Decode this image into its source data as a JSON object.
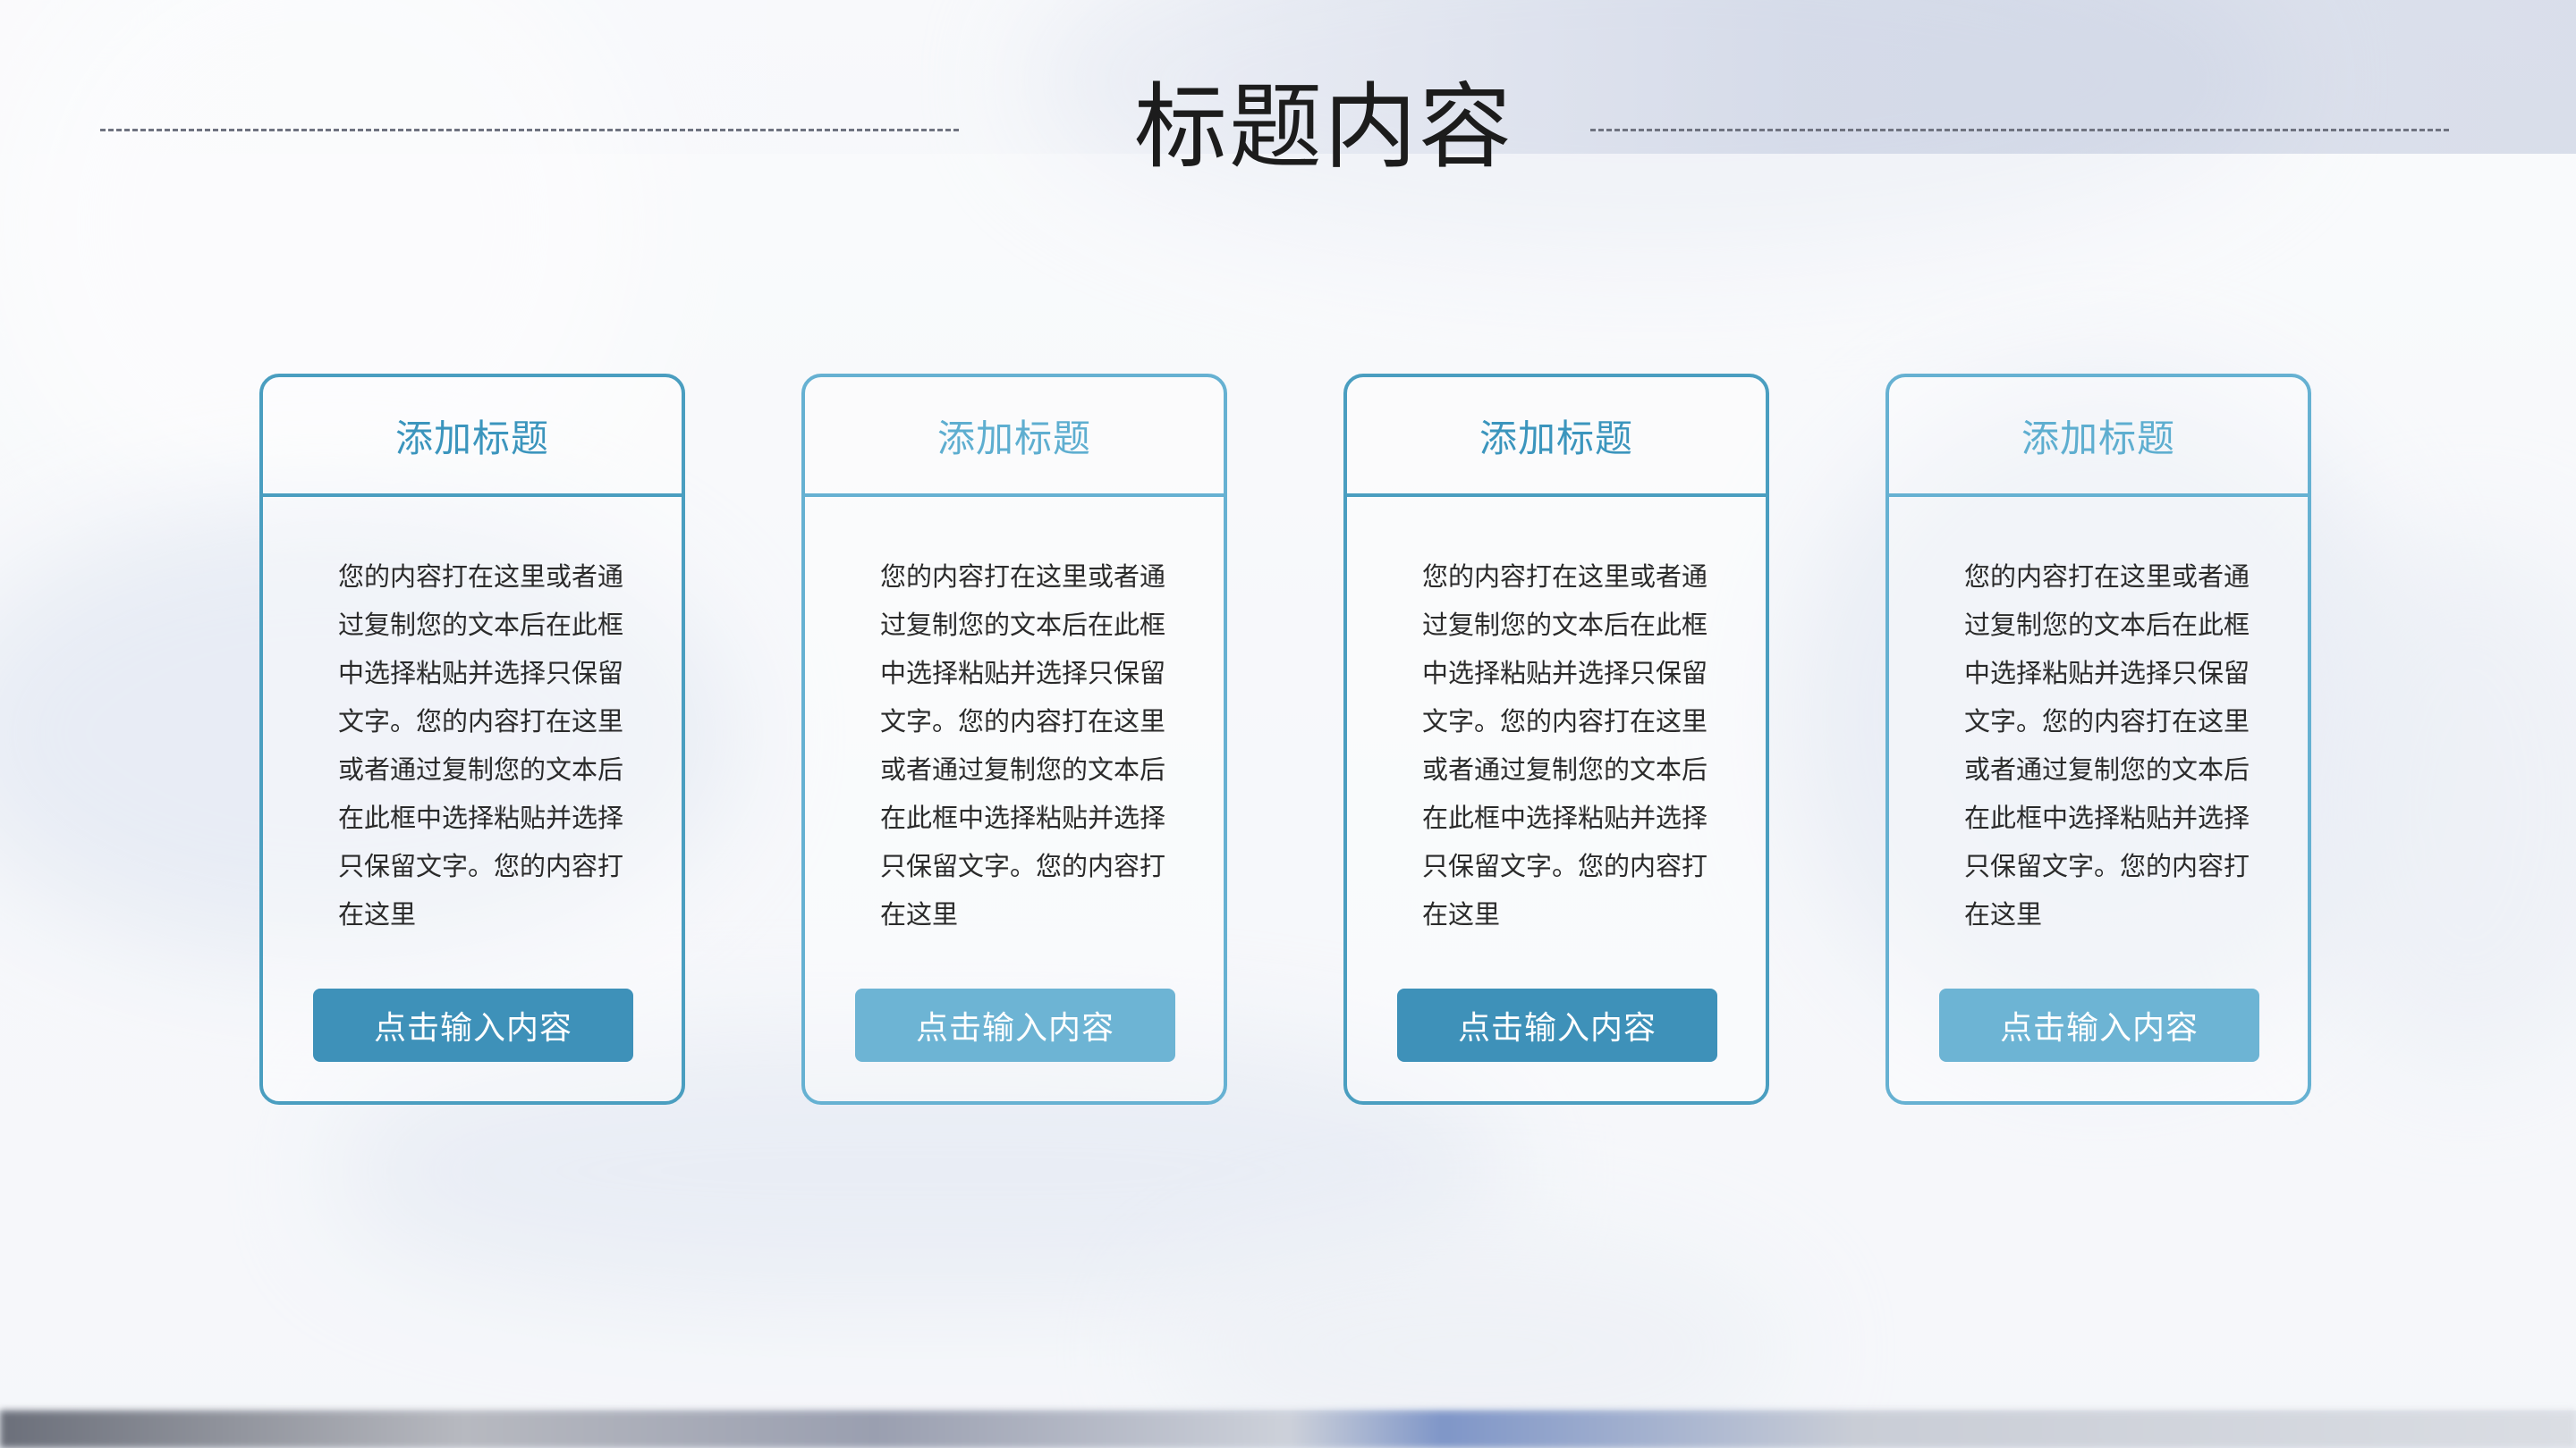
{
  "header": {
    "title": "标题内容"
  },
  "cards": [
    {
      "title": "添加标题",
      "body": "您的内容打在这里或者通过复制您的文本后在此框中选择粘贴并选择只保留文字。您的内容打在这里或者通过复制您的文本后在此框中选择粘贴并选择只保留文字。您的内容打在这里",
      "button_label": "点击输入内容"
    },
    {
      "title": "添加标题",
      "body": "您的内容打在这里或者通过复制您的文本后在此框中选择粘贴并选择只保留文字。您的内容打在这里或者通过复制您的文本后在此框中选择粘贴并选择只保留文字。您的内容打在这里",
      "button_label": "点击输入内容"
    },
    {
      "title": "添加标题",
      "body": "您的内容打在这里或者通过复制您的文本后在此框中选择粘贴并选择只保留文字。您的内容打在这里或者通过复制您的文本后在此框中选择粘贴并选择只保留文字。您的内容打在这里",
      "button_label": "点击输入内容"
    },
    {
      "title": "添加标题",
      "body": "您的内容打在这里或者通过复制您的文本后在此框中选择粘贴并选择只保留文字。您的内容打在这里或者通过复制您的文本后在此框中选择粘贴并选择只保留文字。您的内容打在这里",
      "button_label": "点击输入内容"
    }
  ],
  "colors": {
    "accent_dark": "#3e91b9",
    "accent_light": "#6db4d4",
    "card_border": "#4a9ec0",
    "title_text": "#1c1c1c"
  }
}
